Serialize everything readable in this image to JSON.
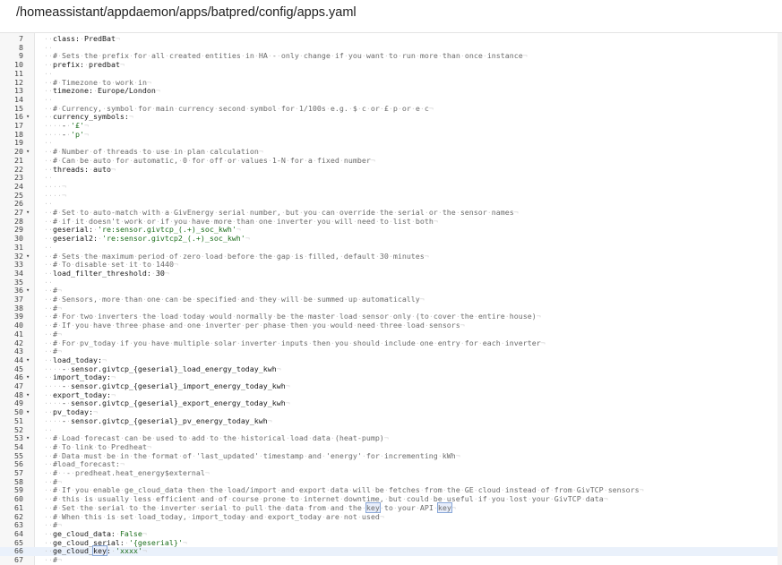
{
  "header": {
    "file_path": "/homeassistant/appdaemon/apps/batpred/config/apps.yaml"
  },
  "colors": {
    "comment": "#6b6b6b",
    "string": "#1d6e1d",
    "key": "#1a1a1a",
    "active_line": "#eaf1fb",
    "gutter": "#f7f7f7"
  },
  "lines": [
    {
      "n": "7",
      "fold": false,
      "segs": [
        {
          "t": "class: PredBat",
          "c": "key"
        }
      ]
    },
    {
      "n": "8",
      "fold": false,
      "segs": []
    },
    {
      "n": "9",
      "fold": false,
      "segs": [
        {
          "t": "# Sets the prefix for all created entities in HA - only change if you want to run more than once instance",
          "c": "comment"
        }
      ]
    },
    {
      "n": "10",
      "fold": false,
      "segs": [
        {
          "t": "prefix: predbat",
          "c": "key"
        }
      ]
    },
    {
      "n": "11",
      "fold": false,
      "segs": []
    },
    {
      "n": "12",
      "fold": false,
      "segs": [
        {
          "t": "# Timezone to work in",
          "c": "comment"
        }
      ]
    },
    {
      "n": "13",
      "fold": false,
      "segs": [
        {
          "t": "timezone: Europe/London",
          "c": "key"
        }
      ]
    },
    {
      "n": "14",
      "fold": false,
      "segs": []
    },
    {
      "n": "15",
      "fold": false,
      "segs": [
        {
          "t": "# Currency, symbol for main currency second symbol for 1/100s e.g. $ c or £ p or e c",
          "c": "comment"
        }
      ]
    },
    {
      "n": "16",
      "fold": true,
      "segs": [
        {
          "t": "currency_symbols:",
          "c": "key"
        }
      ]
    },
    {
      "n": "17",
      "fold": false,
      "segs": [
        {
          "t": "  - ",
          "c": "plain"
        },
        {
          "t": "'£'",
          "c": "string"
        }
      ]
    },
    {
      "n": "18",
      "fold": false,
      "segs": [
        {
          "t": "  - ",
          "c": "plain"
        },
        {
          "t": "'p'",
          "c": "string"
        }
      ]
    },
    {
      "n": "19",
      "fold": false,
      "segs": []
    },
    {
      "n": "20",
      "fold": true,
      "segs": [
        {
          "t": "# Number of threads to use in plan calculation",
          "c": "comment"
        }
      ]
    },
    {
      "n": "21",
      "fold": false,
      "segs": [
        {
          "t": "# Can be auto for automatic, 0 for off or values 1-N for a fixed number",
          "c": "comment"
        }
      ]
    },
    {
      "n": "22",
      "fold": false,
      "segs": [
        {
          "t": "threads: auto",
          "c": "key"
        }
      ]
    },
    {
      "n": "23",
      "fold": false,
      "segs": []
    },
    {
      "n": "24",
      "fold": false,
      "segs": [
        {
          "t": "  ",
          "c": "plain"
        }
      ]
    },
    {
      "n": "25",
      "fold": false,
      "segs": [
        {
          "t": "  ",
          "c": "plain"
        }
      ]
    },
    {
      "n": "26",
      "fold": false,
      "segs": []
    },
    {
      "n": "27",
      "fold": true,
      "segs": [
        {
          "t": "# Set to auto-match with a GivEnergy serial number, but you can override the serial or the sensor names",
          "c": "comment"
        }
      ]
    },
    {
      "n": "28",
      "fold": false,
      "segs": [
        {
          "t": "# if it doesn't work or if you have more than one inverter you will need to list both",
          "c": "comment"
        }
      ]
    },
    {
      "n": "29",
      "fold": false,
      "segs": [
        {
          "t": "geserial: ",
          "c": "key"
        },
        {
          "t": "'re:sensor.givtcp_(.+)_soc_kwh'",
          "c": "string"
        }
      ]
    },
    {
      "n": "30",
      "fold": false,
      "segs": [
        {
          "t": "geserial2: ",
          "c": "key"
        },
        {
          "t": "'re:sensor.givtcp2_(.+)_soc_kwh'",
          "c": "string"
        }
      ]
    },
    {
      "n": "31",
      "fold": false,
      "segs": []
    },
    {
      "n": "32",
      "fold": true,
      "segs": [
        {
          "t": "# Sets the maximum period of zero load before the gap is filled, default 30 minutes",
          "c": "comment"
        }
      ]
    },
    {
      "n": "33",
      "fold": false,
      "segs": [
        {
          "t": "# To disable set it to 1440",
          "c": "comment"
        }
      ]
    },
    {
      "n": "34",
      "fold": false,
      "segs": [
        {
          "t": "load_filter_threshold: 30",
          "c": "key"
        }
      ]
    },
    {
      "n": "35",
      "fold": false,
      "segs": []
    },
    {
      "n": "36",
      "fold": true,
      "segs": [
        {
          "t": "#",
          "c": "comment"
        }
      ]
    },
    {
      "n": "37",
      "fold": false,
      "segs": [
        {
          "t": "# Sensors, more than one can be specified and they will be summed up automatically",
          "c": "comment"
        }
      ]
    },
    {
      "n": "38",
      "fold": false,
      "segs": [
        {
          "t": "#",
          "c": "comment"
        }
      ]
    },
    {
      "n": "39",
      "fold": false,
      "segs": [
        {
          "t": "# For two inverters the load today would normally be the master load sensor only (to cover the entire house)",
          "c": "comment"
        }
      ]
    },
    {
      "n": "40",
      "fold": false,
      "segs": [
        {
          "t": "# If you have three phase and one inverter per phase then you would need three load sensors",
          "c": "comment"
        }
      ]
    },
    {
      "n": "41",
      "fold": false,
      "segs": [
        {
          "t": "#",
          "c": "comment"
        }
      ]
    },
    {
      "n": "42",
      "fold": false,
      "segs": [
        {
          "t": "# For pv_today if you have multiple solar inverter inputs then you should include one entry for each inverter",
          "c": "comment"
        }
      ]
    },
    {
      "n": "43",
      "fold": false,
      "segs": [
        {
          "t": "#",
          "c": "comment"
        }
      ]
    },
    {
      "n": "44",
      "fold": true,
      "segs": [
        {
          "t": "load_today:",
          "c": "key"
        }
      ]
    },
    {
      "n": "45",
      "fold": false,
      "segs": [
        {
          "t": "  - sensor.givtcp_{geserial}_load_energy_today_kwh",
          "c": "plain"
        }
      ]
    },
    {
      "n": "46",
      "fold": true,
      "segs": [
        {
          "t": "import_today:",
          "c": "key"
        }
      ]
    },
    {
      "n": "47",
      "fold": false,
      "segs": [
        {
          "t": "  - sensor.givtcp_{geserial}_import_energy_today_kwh",
          "c": "plain"
        }
      ]
    },
    {
      "n": "48",
      "fold": true,
      "segs": [
        {
          "t": "export_today:",
          "c": "key"
        }
      ]
    },
    {
      "n": "49",
      "fold": false,
      "segs": [
        {
          "t": "  - sensor.givtcp_{geserial}_export_energy_today_kwh",
          "c": "plain"
        }
      ]
    },
    {
      "n": "50",
      "fold": true,
      "segs": [
        {
          "t": "pv_today:",
          "c": "key"
        }
      ]
    },
    {
      "n": "51",
      "fold": false,
      "segs": [
        {
          "t": "  - sensor.givtcp_{geserial}_pv_energy_today_kwh",
          "c": "plain"
        }
      ]
    },
    {
      "n": "52",
      "fold": false,
      "segs": []
    },
    {
      "n": "53",
      "fold": true,
      "segs": [
        {
          "t": "# Load forecast can be used to add to the historical load data (heat-pump)",
          "c": "comment"
        }
      ]
    },
    {
      "n": "54",
      "fold": false,
      "segs": [
        {
          "t": "# To link to Predheat",
          "c": "comment"
        }
      ]
    },
    {
      "n": "55",
      "fold": false,
      "segs": [
        {
          "t": "# Data must be in the format of 'last_updated' timestamp and 'energy' for incrementing kWh",
          "c": "comment"
        }
      ]
    },
    {
      "n": "56",
      "fold": false,
      "segs": [
        {
          "t": "#load_forecast:",
          "c": "comment"
        }
      ]
    },
    {
      "n": "57",
      "fold": false,
      "segs": [
        {
          "t": "#  - predheat.heat_energy$external",
          "c": "comment"
        }
      ]
    },
    {
      "n": "58",
      "fold": false,
      "segs": [
        {
          "t": "#",
          "c": "comment"
        }
      ]
    },
    {
      "n": "59",
      "fold": false,
      "segs": [
        {
          "t": "# If you enable ge_cloud_data then the load/import and export data will be fetches from the GE cloud instead of from GivTCP sensors",
          "c": "comment"
        }
      ]
    },
    {
      "n": "60",
      "fold": false,
      "segs": [
        {
          "t": "# this is usually less efficient and of course prone to internet downtime, but could be useful if you lost your GivTCP data",
          "c": "comment"
        }
      ]
    },
    {
      "n": "61",
      "fold": false,
      "segs": [
        {
          "t": "# Set the serial to the inverter serial to pull the data from and the ",
          "c": "comment"
        },
        {
          "t": "key",
          "c": "comment",
          "hl": true
        },
        {
          "t": " to your API ",
          "c": "comment"
        },
        {
          "t": "key",
          "c": "comment",
          "hl": true
        }
      ]
    },
    {
      "n": "62",
      "fold": false,
      "segs": [
        {
          "t": "# When this is set load_today, import_today and export_today are not used",
          "c": "comment"
        }
      ]
    },
    {
      "n": "63",
      "fold": false,
      "segs": [
        {
          "t": "#",
          "c": "comment"
        }
      ]
    },
    {
      "n": "64",
      "fold": false,
      "segs": [
        {
          "t": "ge_cloud_data: ",
          "c": "key"
        },
        {
          "t": "False",
          "c": "string"
        }
      ]
    },
    {
      "n": "65",
      "fold": false,
      "segs": [
        {
          "t": "ge_cloud_serial: ",
          "c": "key"
        },
        {
          "t": "'{geserial}'",
          "c": "string"
        }
      ]
    },
    {
      "n": "66",
      "fold": false,
      "active": true,
      "segs": [
        {
          "t": "ge_cloud_",
          "c": "key"
        },
        {
          "t": "key",
          "c": "key",
          "hl": true
        },
        {
          "t": ": ",
          "c": "key"
        },
        {
          "t": "'xxxx'",
          "c": "string"
        }
      ]
    },
    {
      "n": "67",
      "fold": false,
      "segs": [
        {
          "t": "#",
          "c": "comment"
        }
      ]
    }
  ]
}
